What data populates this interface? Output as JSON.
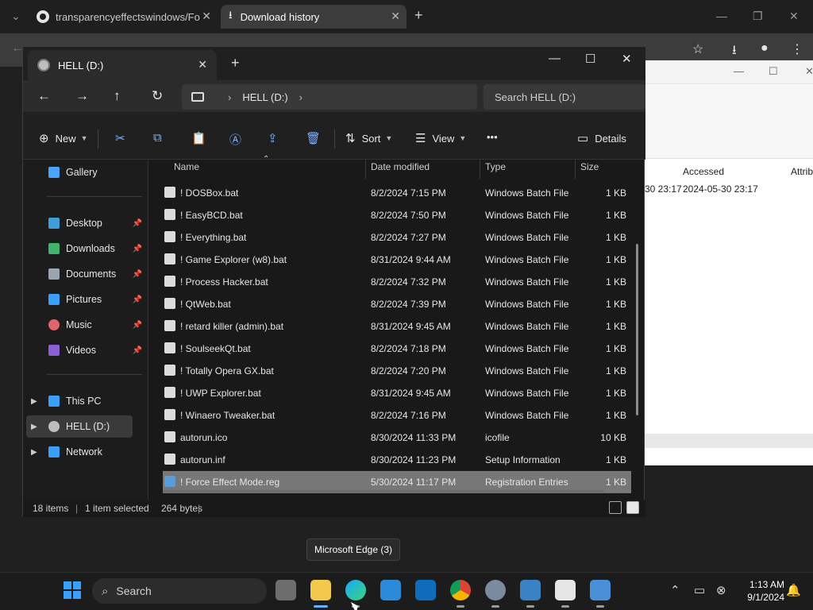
{
  "browser": {
    "tabs": [
      {
        "title": "transparencyeffectswindows/Fo",
        "favicon": "github-icon"
      },
      {
        "title": "Download history",
        "favicon": "download-icon"
      }
    ],
    "colors": {
      "tabbar": "#1f1f1f",
      "toolbar": "#3c3c3c"
    }
  },
  "details_window": {
    "columns": [
      "Accessed",
      "Attrib"
    ],
    "row": {
      "accessed_prev": "-30 23:17",
      "accessed": "2024-05-30 23:17"
    }
  },
  "explorer": {
    "tab_title": "HELL (D:)",
    "address": {
      "location": "HELL (D:)"
    },
    "search_placeholder": "Search HELL (D:)",
    "toolbar": {
      "new": "New",
      "sort": "Sort",
      "view": "View",
      "more": "•••",
      "details": "Details"
    },
    "nav": [
      {
        "label": "Gallery",
        "icon": "gallery-icon",
        "color": "#4aa3ff"
      },
      {
        "label": "Desktop",
        "icon": "desktop-icon",
        "color": "#3f9ddc",
        "pinned": true
      },
      {
        "label": "Downloads",
        "icon": "download-icon",
        "color": "#41b36b",
        "pinned": true
      },
      {
        "label": "Documents",
        "icon": "document-icon",
        "color": "#9aa5b1",
        "pinned": true
      },
      {
        "label": "Pictures",
        "icon": "pictures-icon",
        "color": "#3aa0ff",
        "pinned": true
      },
      {
        "label": "Music",
        "icon": "music-icon",
        "color": "#e0646d",
        "pinned": true
      },
      {
        "label": "Videos",
        "icon": "videos-icon",
        "color": "#8b5fd6",
        "pinned": true
      },
      {
        "label": "This PC",
        "icon": "pc-icon",
        "color": "#3aa0ff"
      },
      {
        "label": "HELL (D:)",
        "icon": "drive-icon",
        "color": "#bdbdbd"
      },
      {
        "label": "Network",
        "icon": "network-icon",
        "color": "#3aa0ff"
      }
    ],
    "columns": {
      "name": "Name",
      "date": "Date modified",
      "type": "Type",
      "size": "Size"
    },
    "files": [
      {
        "name": "! DOSBox.bat",
        "date": "8/2/2024 7:15 PM",
        "type": "Windows Batch File",
        "size": "1 KB"
      },
      {
        "name": "! EasyBCD.bat",
        "date": "8/2/2024 7:50 PM",
        "type": "Windows Batch File",
        "size": "1 KB"
      },
      {
        "name": "! Everything.bat",
        "date": "8/2/2024 7:27 PM",
        "type": "Windows Batch File",
        "size": "1 KB"
      },
      {
        "name": "! Game Explorer (w8).bat",
        "date": "8/31/2024 9:44 AM",
        "type": "Windows Batch File",
        "size": "1 KB"
      },
      {
        "name": "! Process Hacker.bat",
        "date": "8/2/2024 7:32 PM",
        "type": "Windows Batch File",
        "size": "1 KB"
      },
      {
        "name": "! QtWeb.bat",
        "date": "8/2/2024 7:39 PM",
        "type": "Windows Batch File",
        "size": "1 KB"
      },
      {
        "name": "! retard killer (admin).bat",
        "date": "8/31/2024 9:45 AM",
        "type": "Windows Batch File",
        "size": "1 KB"
      },
      {
        "name": "! SoulseekQt.bat",
        "date": "8/2/2024 7:18 PM",
        "type": "Windows Batch File",
        "size": "1 KB"
      },
      {
        "name": "! Totally Opera GX.bat",
        "date": "8/2/2024 7:20 PM",
        "type": "Windows Batch File",
        "size": "1 KB"
      },
      {
        "name": "! UWP Explorer.bat",
        "date": "8/31/2024 9:45 AM",
        "type": "Windows Batch File",
        "size": "1 KB"
      },
      {
        "name": "! Winaero Tweaker.bat",
        "date": "8/2/2024 7:16 PM",
        "type": "Windows Batch File",
        "size": "1 KB"
      },
      {
        "name": "autorun.ico",
        "date": "8/30/2024 11:33 PM",
        "type": "icofile",
        "size": "10 KB"
      },
      {
        "name": "autorun.inf",
        "date": "8/30/2024 11:23 PM",
        "type": "Setup Information",
        "size": "1 KB"
      },
      {
        "name": "! Force Effect Mode.reg",
        "date": "5/30/2024 11:17 PM",
        "type": "Registration Entries",
        "size": "1 KB",
        "selected": true
      }
    ],
    "status": {
      "count": "18 items",
      "selection": "1 item selected",
      "bytes": "264 bytes"
    }
  },
  "tooltip": "Microsoft Edge (3)",
  "taskbar": {
    "search_label": "Search",
    "apps": [
      "task-view",
      "file-explorer",
      "edge",
      "store",
      "outlook",
      "chrome",
      "settings",
      "photos",
      "7zip",
      "snip"
    ],
    "clock": {
      "time": "1:13 AM",
      "date": "9/1/2024"
    }
  }
}
